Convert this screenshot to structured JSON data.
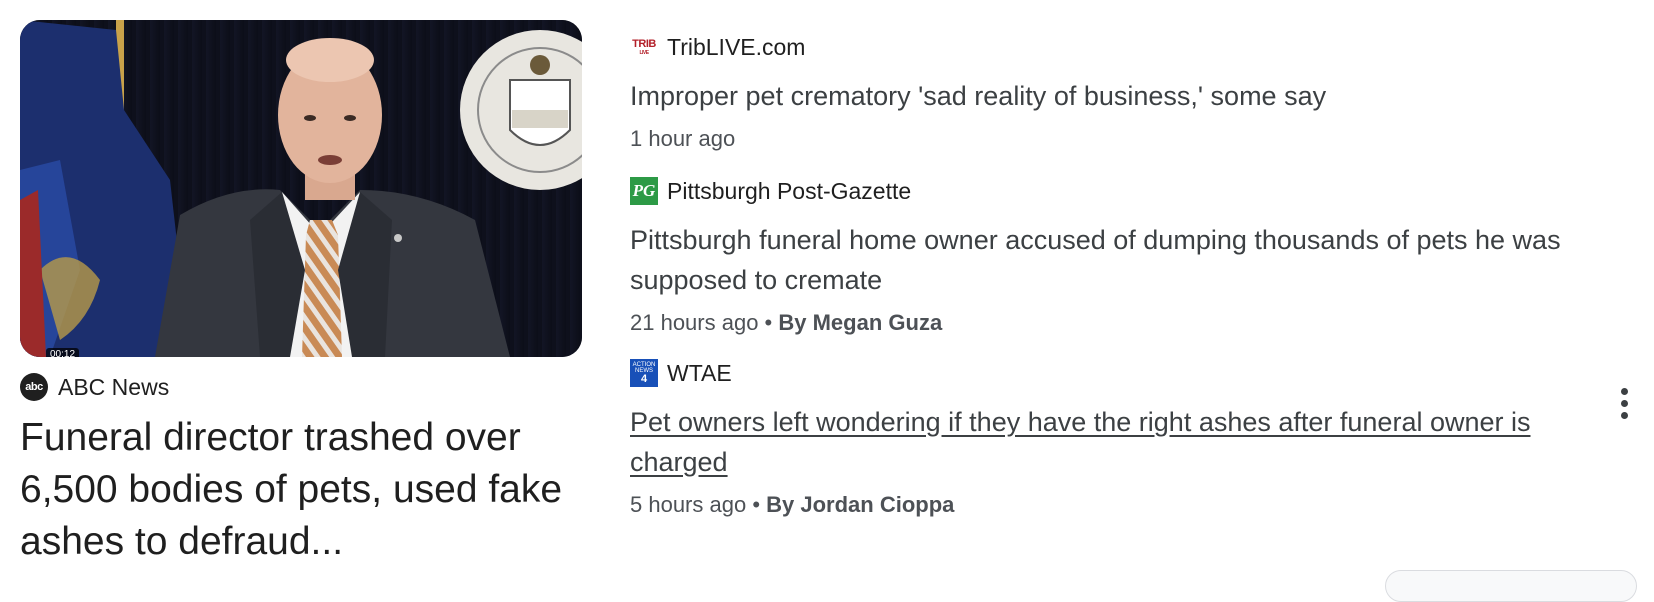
{
  "featured": {
    "thumbnail_icon": "video-thumbnail-speaker-at-podium",
    "duration": "00:12",
    "source_icon": "abc-news-logo",
    "source_logo_text": "abc",
    "source": "ABC News",
    "headline": "Funeral director trashed over 6,500 bodies of pets, used fake ashes to defraud..."
  },
  "stories": [
    {
      "source_icon": "triblive-logo",
      "logo_text": "TRIB",
      "logo_subtext": "LIVE",
      "source": "TribLIVE.com",
      "headline": "Improper pet crematory 'sad reality of business,' some say",
      "time": "1 hour ago"
    },
    {
      "source_icon": "post-gazette-logo",
      "logo_text": "PG",
      "source": "Pittsburgh Post-Gazette",
      "headline": "Pittsburgh funeral home owner accused of dumping thousands of pets he was supposed to cremate",
      "time": "21 hours ago",
      "separator": " • ",
      "author": "By Megan Guza"
    },
    {
      "source_icon": "wtae-logo",
      "logo_text": "ACTION NEWS",
      "logo_number": "4",
      "source": "WTAE",
      "headline": "Pet owners left wondering if they have the right ashes after funeral owner is charged",
      "time": "5 hours ago",
      "separator": " • ",
      "author": "By Jordan Cioppa"
    }
  ],
  "more_options_icon": "more-vert-icon",
  "colors": {
    "headline_text": "#1f1f1f",
    "secondary_text": "#4d5156",
    "pg_green": "#2d9a46",
    "trib_red": "#b3202a",
    "wtae_blue": "#1850b8"
  }
}
